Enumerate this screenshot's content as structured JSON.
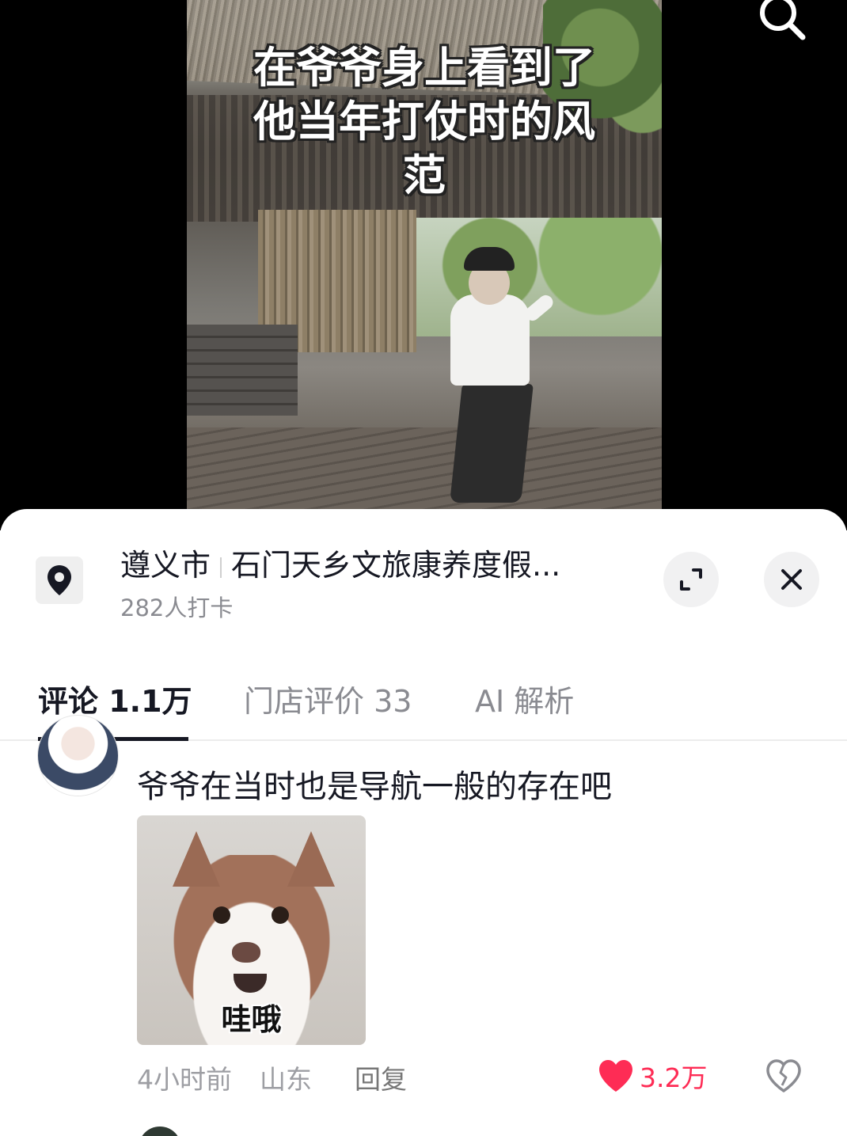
{
  "video": {
    "caption": "在爷爷身上看到了他当年打仗时的风范"
  },
  "location": {
    "city": "遵义市",
    "name": "石门天乡文旅康养度假...",
    "checkins": "282人打卡"
  },
  "tabs": [
    {
      "label": "评论 1.1万",
      "active": true
    },
    {
      "label": "门店评价 33",
      "active": false
    },
    {
      "label": "AI 解析",
      "active": false
    }
  ],
  "comment": {
    "text": "爷爷在当时也是导航一般的存在吧",
    "sticker_label": "哇哦",
    "time": "4小时前",
    "region": "山东",
    "reply_label": "回复",
    "likes": "3.2万"
  },
  "colors": {
    "like": "#fe2c55",
    "text_primary": "#161823",
    "text_secondary": "#8a8b91"
  },
  "icons": [
    "search-icon",
    "location-pin-icon",
    "expand-icon",
    "close-icon",
    "heart-icon",
    "broken-heart-icon"
  ]
}
